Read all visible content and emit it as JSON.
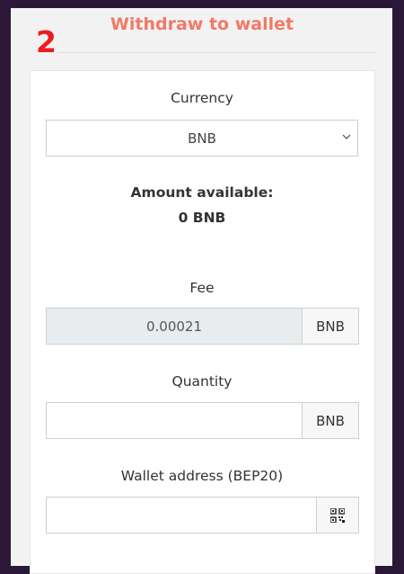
{
  "step_number": "2",
  "title": "Withdraw to wallet",
  "currency": {
    "label": "Currency",
    "selected": "BNB"
  },
  "available": {
    "label": "Amount available:",
    "value": "0 BNB"
  },
  "fee": {
    "label": "Fee",
    "value": "0.00021",
    "unit": "BNB"
  },
  "quantity": {
    "label": "Quantity",
    "value": "",
    "unit": "BNB"
  },
  "wallet": {
    "label": "Wallet address (BEP20)",
    "value": "",
    "scan_icon": "qr-code-icon"
  },
  "colors": {
    "title": "#f07a66",
    "step_number": "#ee1c1c",
    "background": "#2b1838"
  }
}
